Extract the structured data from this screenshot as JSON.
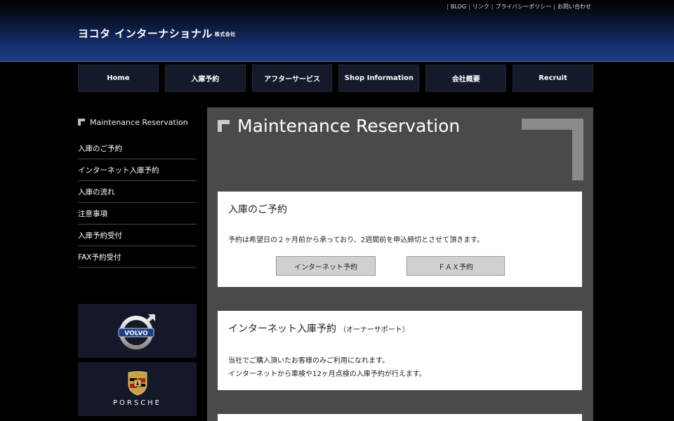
{
  "header": {
    "top_links": [
      "BLOG",
      "リンク",
      "プライバシーポリシー",
      "お問い合わせ"
    ],
    "logo_text": "ヨコタ インターナショナル",
    "logo_small": "株式会社"
  },
  "nav": [
    "Home",
    "入庫予約",
    "アフターサービス",
    "Shop Information",
    "会社概要",
    "Recruit"
  ],
  "sidebar": {
    "title": "Maintenance Reservation",
    "items": [
      "入庫のご予約",
      "インターネット入庫予約",
      "入庫の流れ",
      "注意事項",
      "入庫予約受付",
      "FAX予約受付"
    ],
    "brands": {
      "porsche_label": "PORSCHE",
      "volvo_label": "VOLVO"
    }
  },
  "main": {
    "title": "Maintenance Reservation",
    "card1": {
      "heading": "入庫のご予約",
      "text": "予約は希望日の２ヶ月前から承っており、2週間前を申込締切とさせて頂きます。",
      "btn_internet": "インターネット予約",
      "btn_fax": "ＦＡＸ予約"
    },
    "card2": {
      "heading": "インターネット入庫予約",
      "heading_sub": "（オーナーサポート）",
      "line1": "当社でご購入頂いたお客様のみご利用になれます。",
      "line2": "インターネットから車検や12ヶ月点検の入庫予約が行えます。"
    }
  },
  "colors": {
    "background": "#000000",
    "header_blue": "#1c3f8a",
    "nav_bg": "#151a2a",
    "main_bg": "#4a4a4a"
  }
}
